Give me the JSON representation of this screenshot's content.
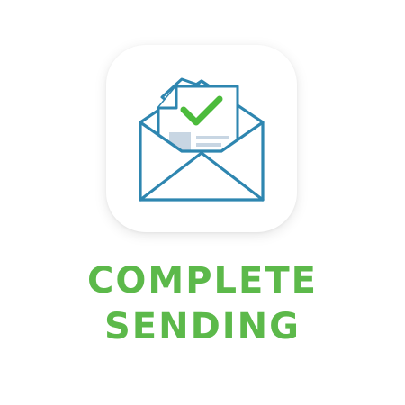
{
  "icon": {
    "name": "envelope-checkmark-icon",
    "outline_color": "#2e86b0",
    "check_color": "#4cbb3c",
    "paper_color": "#ffffff",
    "content_block_color": "#c8d6e3",
    "card_color": "#ffffff"
  },
  "caption": {
    "line1": "COMPLETE",
    "line2": "SENDING",
    "color": "#5cb94a"
  }
}
